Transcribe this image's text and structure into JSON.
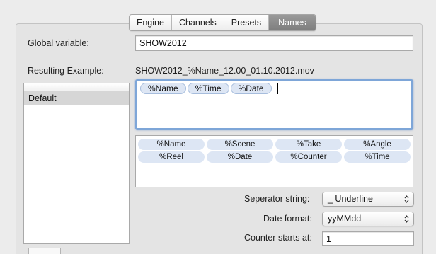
{
  "tabs": [
    {
      "label": "Engine",
      "active": false
    },
    {
      "label": "Channels",
      "active": false
    },
    {
      "label": "Presets",
      "active": false
    },
    {
      "label": "Names",
      "active": true
    }
  ],
  "global_variable": {
    "label": "Global variable:",
    "value": "SHOW2012"
  },
  "resulting_example": {
    "label": "Resulting Example:",
    "value": "SHOW2012_%Name_12.00_01.10.2012.mov"
  },
  "presets_list": {
    "items": [
      "Default"
    ]
  },
  "format_tokens": [
    "%Name",
    "%Time",
    "%Date"
  ],
  "available_tokens": [
    "%Name",
    "%Scene",
    "%Take",
    "%Angle",
    "%Reel",
    "%Date",
    "%Counter",
    "%Time"
  ],
  "separator": {
    "label": "Seperator string:",
    "value": "_ Underline"
  },
  "date_format": {
    "label": "Date format:",
    "value": "yyMMdd"
  },
  "counter": {
    "label": "Counter starts at:",
    "value": "1"
  },
  "colors": {
    "token_fill": "#dde6f4",
    "focus_ring": "#7ea6d8",
    "active_tab": "#8a8a8a"
  },
  "icons": {
    "select_arrows": "up-down-chevron-icon"
  }
}
